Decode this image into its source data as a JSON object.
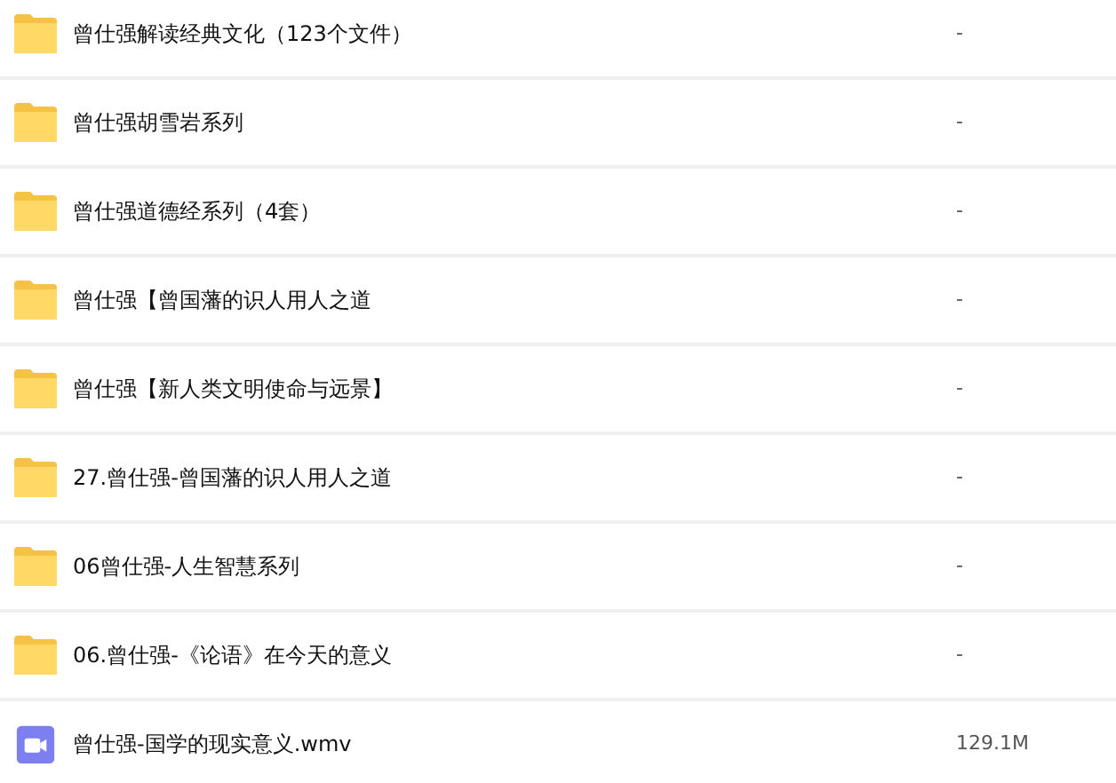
{
  "files": [
    {
      "kind": "folder",
      "name": "曾仕强解读经典文化（123个文件）",
      "size": "-"
    },
    {
      "kind": "folder",
      "name": "曾仕强胡雪岩系列",
      "size": "-"
    },
    {
      "kind": "folder",
      "name": "曾仕强道德经系列（4套）",
      "size": "-"
    },
    {
      "kind": "folder",
      "name": "曾仕强【曾国藩的识人用人之道",
      "size": "-"
    },
    {
      "kind": "folder",
      "name": "曾仕强【新人类文明使命与远景】",
      "size": "-"
    },
    {
      "kind": "folder",
      "name": "27.曾仕强-曾国藩的识人用人之道",
      "size": "-"
    },
    {
      "kind": "folder",
      "name": "06曾仕强-人生智慧系列",
      "size": "-"
    },
    {
      "kind": "folder",
      "name": "06.曾仕强-《论语》在今天的意义",
      "size": "-"
    },
    {
      "kind": "video",
      "name": "曾仕强-国学的现实意义.wmv",
      "size": "129.1M"
    }
  ]
}
